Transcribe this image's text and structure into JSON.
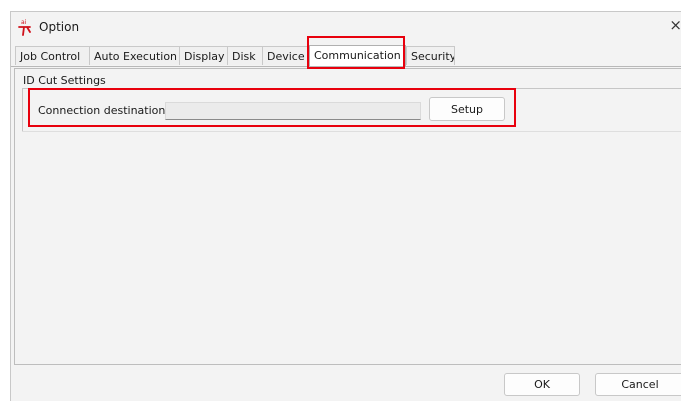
{
  "window": {
    "title": "Option",
    "close_glyph": "×",
    "app_icon": "app-logo-icon"
  },
  "tabs": [
    {
      "label": "Job Control",
      "active": false
    },
    {
      "label": "Auto Execution",
      "active": false
    },
    {
      "label": "Display",
      "active": false
    },
    {
      "label": "Disk",
      "active": false
    },
    {
      "label": "Device",
      "active": false
    },
    {
      "label": "Communication",
      "active": true
    },
    {
      "label": "Security",
      "active": false
    }
  ],
  "id_cut": {
    "group_label": "ID Cut Settings",
    "connection_label": "Connection destination",
    "connection_value": "",
    "setup_label": "Setup"
  },
  "footer": {
    "ok_label": "OK",
    "cancel_label": "Cancel"
  },
  "highlight_color": "#e8000d"
}
